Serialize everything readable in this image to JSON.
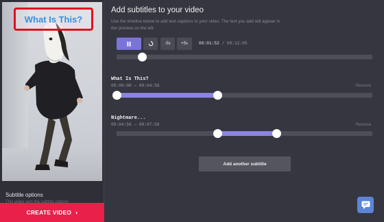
{
  "preview": {
    "caption_text": "What Is This?",
    "options_title": "Subtitle options",
    "options_subtitle": "This video sets the subtitle options"
  },
  "create_button": {
    "label": "CREATE VIDEO",
    "icon": "chevron-right-icon"
  },
  "header": {
    "title": "Add subtitles to your video",
    "description": "Use the timeline below to add text captions to your video. The text you add will appear in the preview on the left."
  },
  "controls": {
    "play_icon": "pause-icon",
    "reset_icon": "replay-icon",
    "back_label": "-5s",
    "forward_label": "+5s",
    "current_time": "00:01:52",
    "separator": "/",
    "total_time": "00:12:05",
    "playhead_fraction": 0.1
  },
  "subtitles": [
    {
      "name": "What Is This?",
      "range": "00:00:00 — 00:04:56",
      "remove_label": "Remove",
      "start_fraction": 0.0,
      "end_fraction": 0.396
    },
    {
      "name": "Nightmare...",
      "range": "00:04:56 — 00:07:56",
      "remove_label": "Remove",
      "start_fraction": 0.396,
      "end_fraction": 0.626
    }
  ],
  "add_button": {
    "label": "Add another subtitle"
  },
  "chat": {
    "icon": "chat-bubble-icon"
  },
  "colors": {
    "accent": "#7a74d8",
    "create": "#e8204a",
    "caption_border": "#e01020",
    "caption_text": "#3a8fe0",
    "chat": "#5b86d6"
  }
}
